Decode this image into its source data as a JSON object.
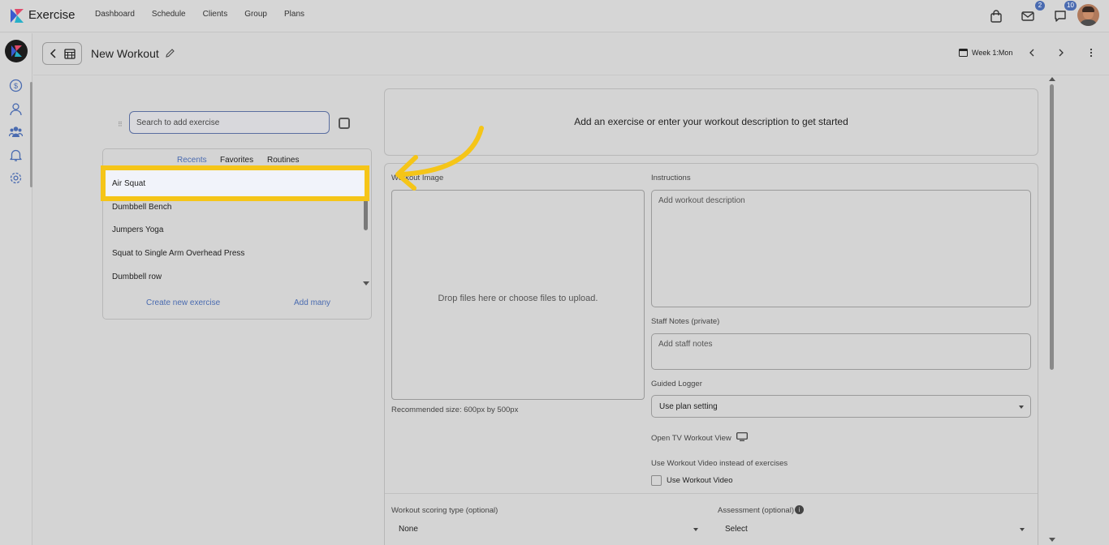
{
  "app": {
    "name": "Exercise"
  },
  "nav": [
    "Dashboard",
    "Schedule",
    "Clients",
    "Group",
    "Plans"
  ],
  "badges": {
    "mail": "2",
    "chat": "10"
  },
  "header": {
    "title": "New Workout",
    "week": "Week 1:Mon"
  },
  "search": {
    "placeholder": "Search to add exercise"
  },
  "tabs": [
    "Recents",
    "Favorites",
    "Routines"
  ],
  "exercises": [
    "Air Squat",
    "Dumbbell Bench",
    "Jumpers Yoga",
    "Squat to Single Arm Overhead Press",
    "Dumbbell row"
  ],
  "panel_links": {
    "create": "Create new exercise",
    "add_many": "Add many"
  },
  "start_message": "Add an exercise or enter your workout description to get started",
  "form": {
    "workout_image_label": "Workout Image",
    "drop_text": "Drop files here or choose files to upload.",
    "recommended": "Recommended size: 600px by 500px",
    "instructions_label": "Instructions",
    "instructions_placeholder": "Add workout description",
    "staff_notes_label": "Staff Notes (private)",
    "staff_notes_placeholder": "Add staff notes",
    "guided_logger_label": "Guided Logger",
    "guided_logger_value": "Use plan setting",
    "tv_view": "Open TV Workout View",
    "video_label": "Use Workout Video instead of exercises",
    "video_checkbox": "Use Workout Video",
    "scoring_label": "Workout scoring type (optional)",
    "scoring_value": "None",
    "assessment_label": "Assessment (optional)",
    "assessment_value": "Select"
  },
  "colors": {
    "accent": "#4a6bb0",
    "highlight": "#f5c518"
  }
}
